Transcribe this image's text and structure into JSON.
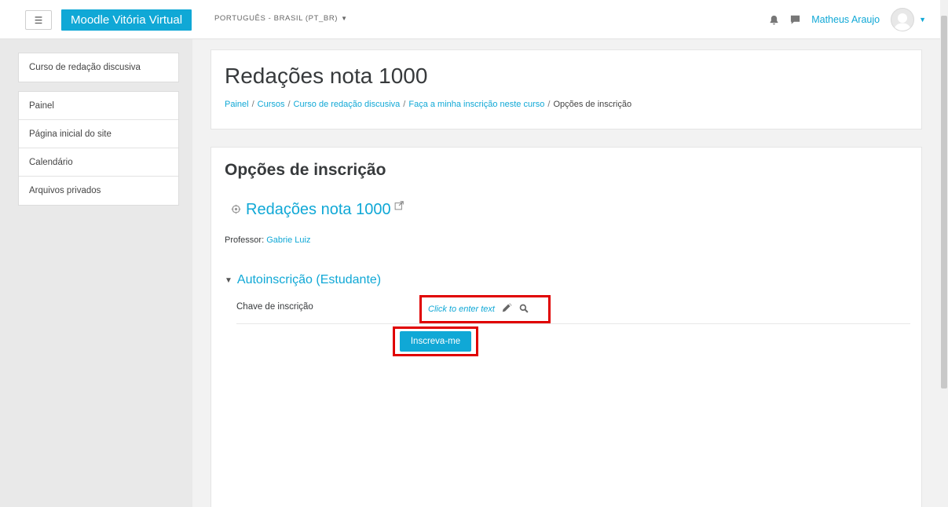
{
  "navbar": {
    "brand": "Moodle Vitória Virtual",
    "language": "PORTUGUÊS - BRASIL (PT_BR)",
    "username": "Matheus Araujo",
    "icons": [
      "menu-icon",
      "bell-icon",
      "chat-icon",
      "user-avatar-icon",
      "chevron-down-icon"
    ]
  },
  "drawer": {
    "course": "Curso de redação discusiva",
    "items": [
      "Painel",
      "Página inicial do site",
      "Calendário",
      "Arquivos privados"
    ]
  },
  "header": {
    "title": "Redações nota 1000",
    "breadcrumb": [
      "Painel",
      "Cursos",
      "Curso de redação discusiva",
      "Faça a minha inscrição neste curso",
      "Opções de inscrição"
    ]
  },
  "main": {
    "section_title": "Opções de inscrição",
    "course_name": "Redações nota 1000",
    "teacher_label": "Professor:",
    "teacher_name": "Gabrie Luiz",
    "enrol_heading": "Autoinscrição (Estudante)",
    "key_label": "Chave de inscrição",
    "key_placeholder": "Click to enter text",
    "submit_label": "Inscreva-me"
  },
  "colors": {
    "accent": "#10a8d6",
    "highlight_box": "#e00000"
  }
}
